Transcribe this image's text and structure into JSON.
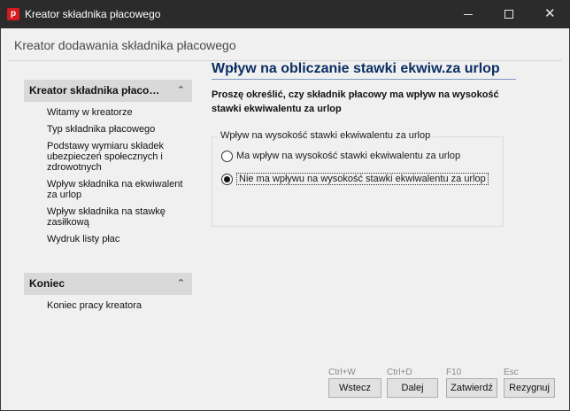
{
  "window": {
    "app_icon_letter": "p",
    "title": "Kreator składnika płacowego",
    "close_glyph": "✕"
  },
  "header": {
    "title": "Kreator dodawania składnika płacowego"
  },
  "sidebar": {
    "panels": [
      {
        "title": "Kreator składnika płaco…",
        "chevron": "⌃",
        "items": [
          "Witamy w kreatorze",
          "Typ składnika płacowego",
          "Podstawy wymiaru składek ubezpieczeń społecznych i zdrowotnych",
          "Wpływ składnika na ekwiwalent za urlop",
          "Wpływ składnika na stawkę zasiłkową",
          "Wydruk listy płac"
        ]
      },
      {
        "title": "Koniec",
        "chevron": "⌃",
        "items": [
          "Koniec pracy kreatora"
        ]
      }
    ]
  },
  "content": {
    "title": "Wpływ na obliczanie stawki ekwiw.za urlop",
    "question": "Proszę określić, czy składnik płacowy ma wpływ na wysokość stawki ekwiwalentu za urlop",
    "group_label": "Wpływ na wysokość stawki ekwiwalentu za urlop",
    "options": [
      {
        "label": "Ma wpływ na wysokość stawki ekwiwalentu za urlop",
        "selected": false
      },
      {
        "label": "Nie ma wpływu na wysokość stawki ekwiwalentu za urlop",
        "selected": true
      }
    ]
  },
  "footer": {
    "buttons": [
      {
        "label": "Wstecz",
        "shortcut": "Ctrl+W"
      },
      {
        "label": "Dalej",
        "shortcut": "Ctrl+D"
      },
      {
        "label": "Zatwierdź",
        "shortcut": "F10"
      },
      {
        "label": "Rezygnuj",
        "shortcut": "Esc"
      }
    ]
  },
  "colors": {
    "titlebar": "#2b2b2b",
    "app_icon": "#d71920",
    "content_title": "#0b2f63",
    "panel_header": "#d9d9d9",
    "background": "#f0f0f0"
  }
}
